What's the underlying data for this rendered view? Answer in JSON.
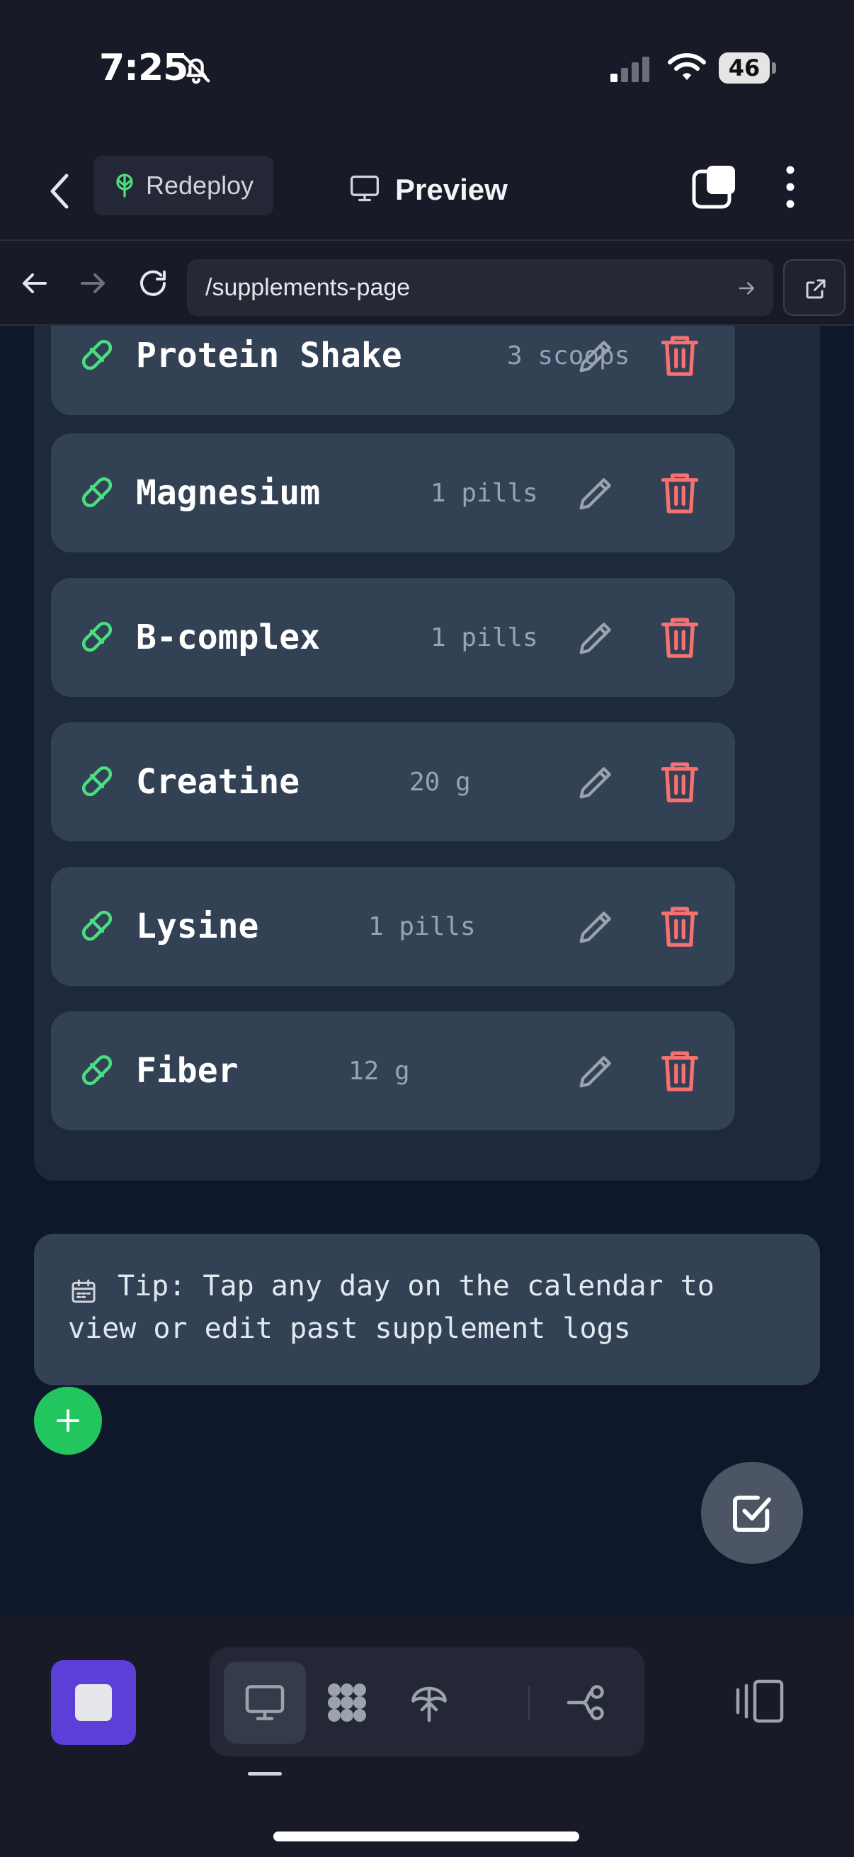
{
  "status_bar": {
    "time": "7:25",
    "battery": "46",
    "icons": [
      "bell-slash-icon",
      "cellular-signal-icon",
      "wifi-icon",
      "battery-icon"
    ]
  },
  "header": {
    "back_icon": "chevron-left-icon",
    "redeploy_label": "Redeploy",
    "redeploy_icon": "deploy-tree-icon",
    "title": "Preview",
    "title_icon": "monitor-icon",
    "tabs_icon": "tabs-icon",
    "more_icon": "vertical-dots-icon"
  },
  "url_bar": {
    "url": "/supplements-page",
    "icons": [
      "arrow-left-icon",
      "arrow-right-icon",
      "reload-icon",
      "go-arrow-icon",
      "external-link-icon"
    ]
  },
  "supplements": [
    {
      "name": "Protein Shake",
      "dose": "3 scoops"
    },
    {
      "name": "Magnesium",
      "dose": "1 pills"
    },
    {
      "name": "B-complex",
      "dose": "1 pills"
    },
    {
      "name": "Creatine",
      "dose": "20 g"
    },
    {
      "name": "Lysine",
      "dose": "1 pills"
    },
    {
      "name": "Fiber",
      "dose": "12 g"
    }
  ],
  "tip": {
    "text": "Tip: Tap any day on the calendar to view or edit past supplement logs",
    "icon": "calendar-icon"
  },
  "fabs": {
    "add_icon": "plus-icon",
    "check_icon": "checkbox-icon"
  },
  "toolbar": {
    "icons": [
      "stop-icon",
      "monitor-icon",
      "apps-grid-icon",
      "deploy-icon",
      "share-branch-icon",
      "sidebar-toggle-icon"
    ]
  },
  "colors": {
    "background": "#0f172a",
    "panel": "#1e293b",
    "row": "#334155",
    "pill_green": "#4ade80",
    "delete_red": "#f87171",
    "fab_green": "#22c55e",
    "stop_purple": "#5b3fd6"
  }
}
